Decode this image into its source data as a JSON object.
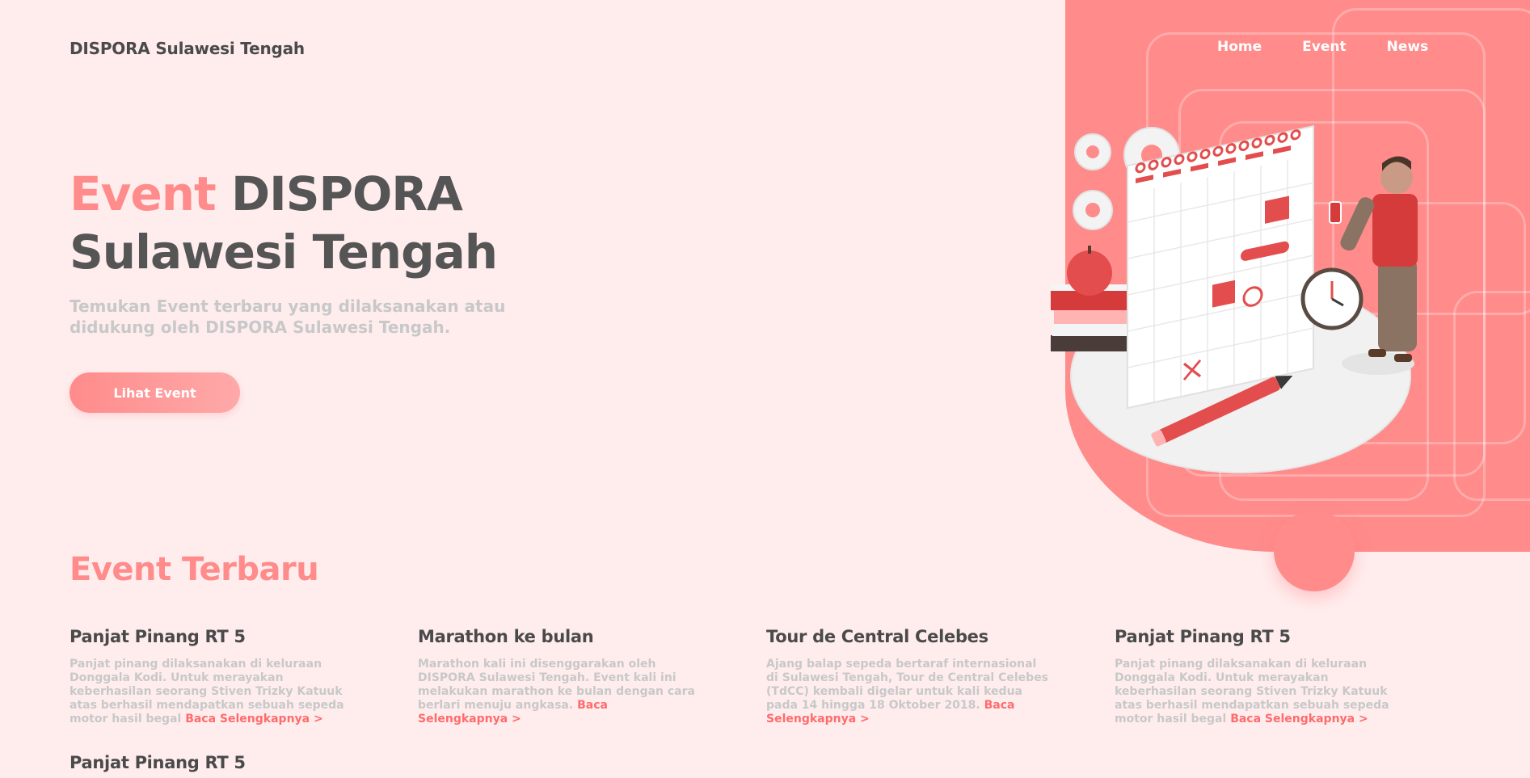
{
  "header": {
    "brand": "DISPORA Sulawesi Tengah",
    "nav": [
      "Home",
      "Event",
      "News"
    ]
  },
  "hero": {
    "title_accent": "Event",
    "title_rest": "DISPORA Sulawesi Tengah",
    "subtitle": "Temukan Event terbaru yang dilaksanakan atau didukung oleh DISPORA Sulawesi Tengah.",
    "cta_label": "Lihat Event",
    "illustration_icon": "calendar-planning-illustration"
  },
  "events": {
    "section_title": "Event Terbaru",
    "read_more": "Baca Selengkapnya >",
    "items": [
      {
        "title": "Panjat Pinang RT 5",
        "desc": "Panjat pinang dilaksanakan di keluraan Donggala Kodi. Untuk merayakan keberhasilan seorang Stiven Trizky Katuuk atas berhasil mendapatkan sebuah sepeda motor hasil begal"
      },
      {
        "title": "Marathon ke bulan",
        "desc": "Marathon kali ini disenggarakan oleh DISPORA Sulawesi Tengah. Event kali ini melakukan marathon ke bulan dengan cara berlari menuju angkasa."
      },
      {
        "title": "Tour de Central Celebes",
        "desc": "Ajang balap sepeda bertaraf internasional di Sulawesi Tengah, Tour de Central Celebes (TdCC) kembali digelar untuk kali kedua pada 14 hingga 18 Oktober 2018."
      },
      {
        "title": "Panjat Pinang RT 5",
        "desc": "Panjat pinang dilaksanakan di keluraan Donggala Kodi. Untuk merayakan keberhasilan seorang Stiven Trizky Katuuk atas berhasil mendapatkan sebuah sepeda motor hasil begal"
      },
      {
        "title": "Panjat Pinang RT 5"
      }
    ]
  },
  "colors": {
    "background": "#ffedee",
    "accent": "#ff8b8b",
    "heading": "#555555",
    "muted": "#c8c8c8"
  }
}
